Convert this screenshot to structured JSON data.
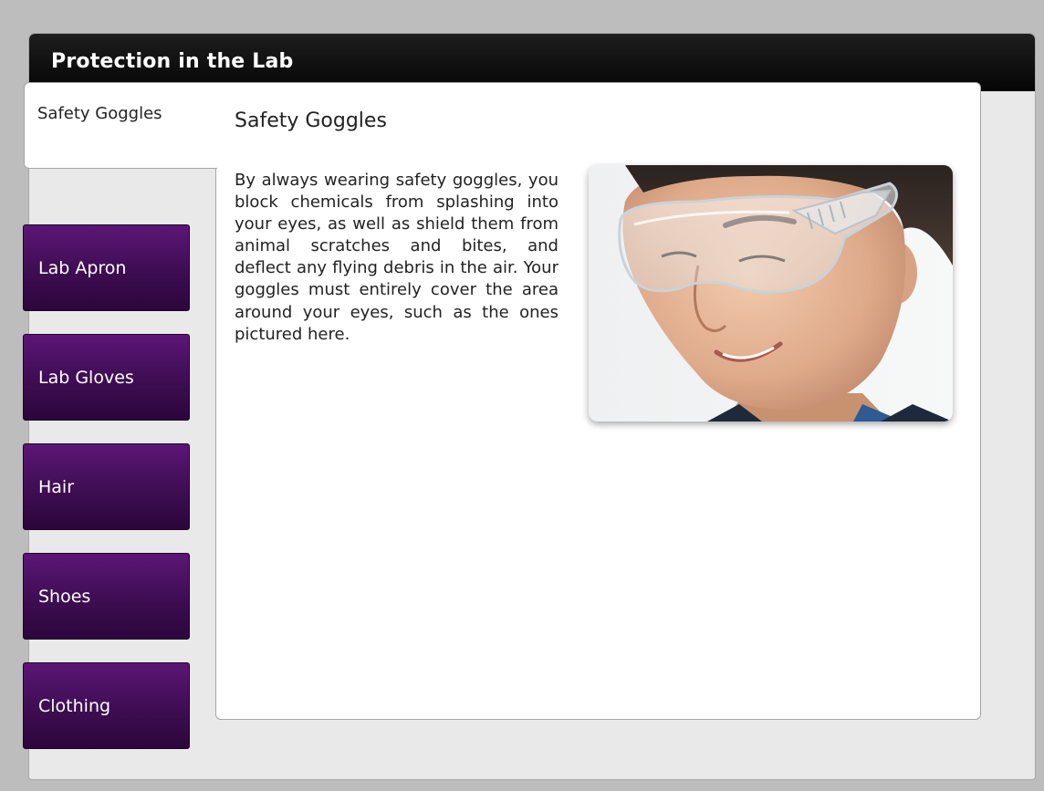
{
  "window": {
    "title": "Protection in the Lab"
  },
  "tabs": [
    {
      "label": "Safety Goggles",
      "active": true
    },
    {
      "label": "Lab Apron",
      "active": false
    },
    {
      "label": "Lab Gloves",
      "active": false
    },
    {
      "label": "Hair",
      "active": false
    },
    {
      "label": "Shoes",
      "active": false
    },
    {
      "label": "Clothing",
      "active": false
    }
  ],
  "content": {
    "heading": "Safety Goggles",
    "body": "By always wearing safety goggles, you block chemicals from splashing into your eyes, as well as shield them from animal scratches and bites, and deflect any flying debris in the air. Your goggles must entirely cover the area around your eyes, such as the ones pictured here.",
    "image": "photo of a young man wearing clear safety goggles"
  },
  "colors": {
    "titlebar": "#0a0a0a",
    "tab_purple": "#3e0d52",
    "panel_bg": "#ffffff",
    "frame_bg": "#e9e9e9"
  }
}
